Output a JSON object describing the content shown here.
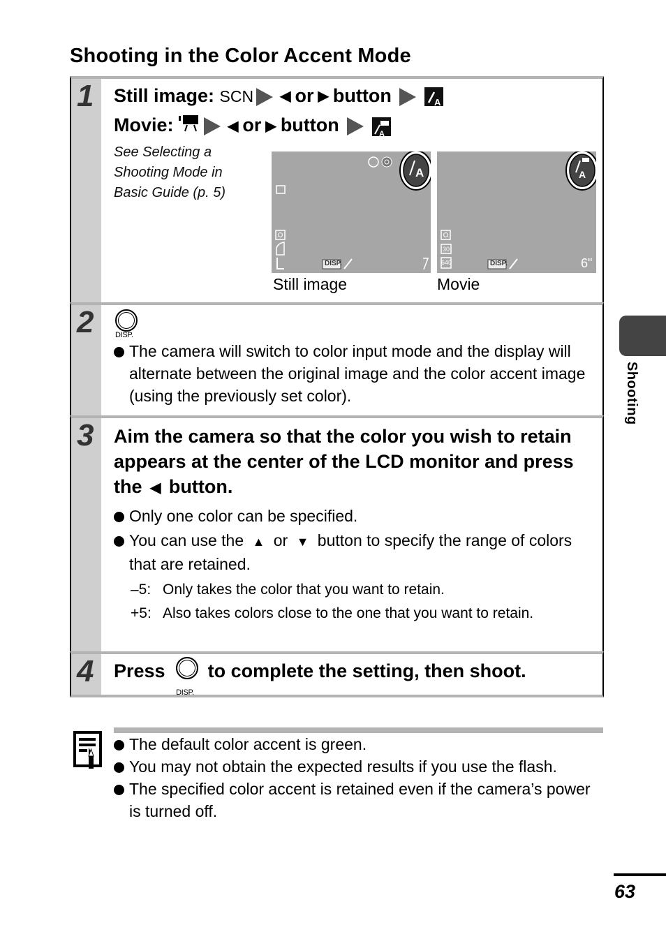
{
  "page": {
    "title": "Shooting in the Color Accent Mode",
    "side_tab": "Shooting",
    "page_number": "63"
  },
  "steps": [
    {
      "number": "1",
      "line1": {
        "label": "Still image:",
        "mode_text": "SCN",
        "or": "or",
        "button": "button"
      },
      "line2": {
        "label": "Movie:",
        "or": "or",
        "button": "button"
      },
      "reference": "See Selecting a Shooting Mode in Basic Guide (p. 5)",
      "reference_lines": [
        "See Selecting a",
        "Shooting Mode in",
        "Basic Guide (p. 5)"
      ],
      "screens": [
        {
          "caption": "Still image",
          "shots_remaining": "7",
          "disp": "DISP.",
          "size": "L"
        },
        {
          "caption": "Movie",
          "time_remaining": "6\"",
          "disp": "DISP.",
          "frame_rate": "30",
          "resolution": "640"
        }
      ]
    },
    {
      "number": "2",
      "button_label": "DISP.",
      "bullets": [
        "The camera will switch to color input mode and the display will alternate between the original image and the color accent image (using the previously set color)."
      ]
    },
    {
      "number": "3",
      "heading_part1": "Aim the camera so that the color you wish to retain appears at the center of the LCD monitor and press the",
      "heading_part2": "button.",
      "bullets": [
        "Only one color can be specified."
      ],
      "bullet2_a": "You can use the",
      "bullet2_or": "or",
      "bullet2_b": "button to specify the range of colors that are retained.",
      "range": [
        {
          "key": "–5:",
          "text": "Only takes the color that you want to retain."
        },
        {
          "key": "+5:",
          "text": "Also takes colors close to the one that you want to retain."
        }
      ]
    },
    {
      "number": "4",
      "text_a": "Press",
      "button_label": "DISP.",
      "text_b": "to complete the setting, then shoot."
    }
  ],
  "notes": [
    "The default color accent is green.",
    "You may not obtain the expected results if you use the flash.",
    "The specified color accent is retained even if the camera’s power is turned off."
  ],
  "colors": {
    "step_number_bg": "#cfcfcf",
    "rule_gray": "#b3b3b3",
    "lcd_bg": "#a6a6a6",
    "side_tab": "#444444"
  }
}
